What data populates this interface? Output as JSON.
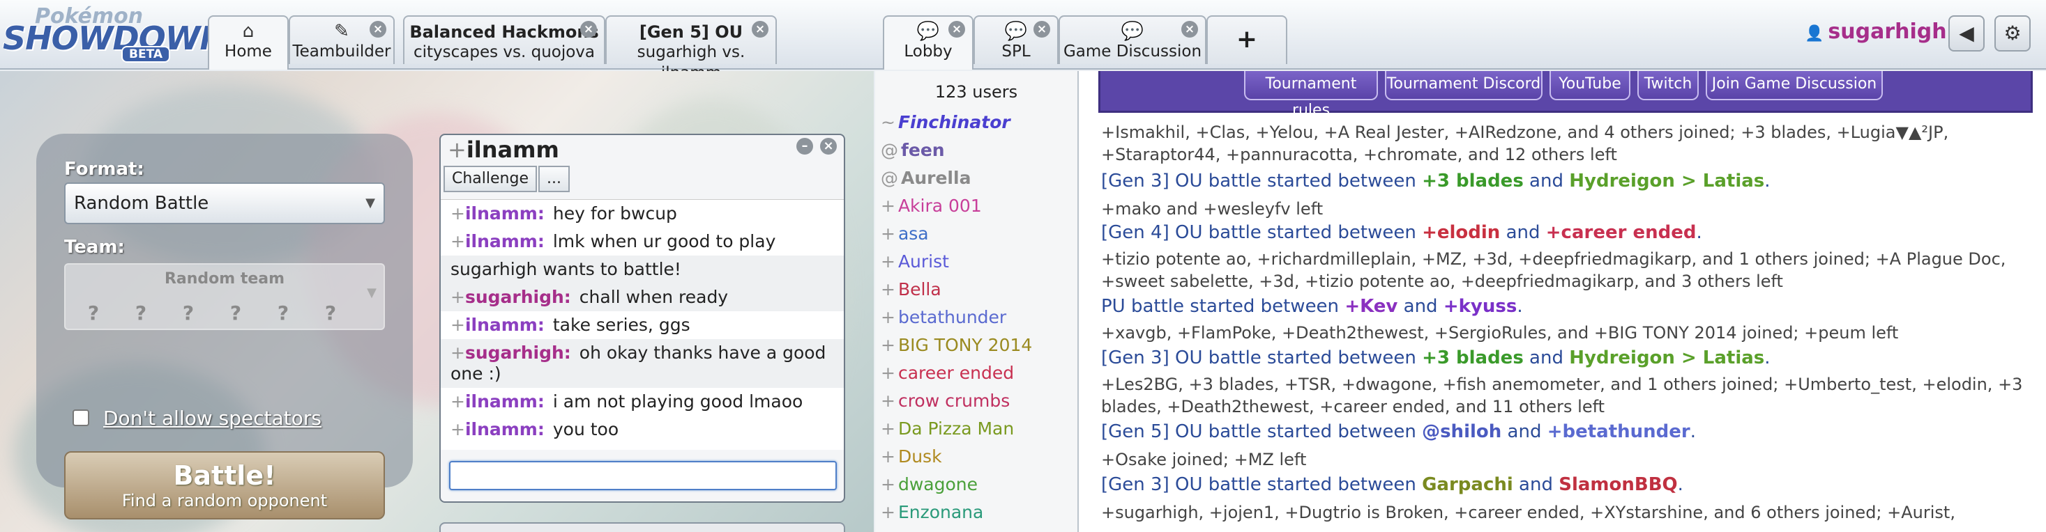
{
  "header": {
    "logo_top": "Pokémon",
    "logo_main": "SHOWDOWN!",
    "logo_badge": "BETA",
    "tabs": [
      {
        "label": "Home",
        "icon": "home-icon"
      },
      {
        "label": "Teambuilder",
        "icon": "edit-icon"
      },
      {
        "line1": "Balanced Hackmons",
        "line2": "cityscapes vs. quojova"
      },
      {
        "line1": "[Gen 5] OU",
        "line2": "sugarhigh vs. ilnamm"
      },
      {
        "label": "Lobby",
        "icon": "chat-bubble-icon"
      },
      {
        "label": "SPL",
        "icon": "chat-bubble-icon"
      },
      {
        "label": "Game Discussion",
        "icon": "chat-bubble-icon"
      }
    ],
    "plus_label": "+",
    "username": "sugarhigh"
  },
  "home": {
    "format_label": "Format:",
    "format_value": "Random Battle",
    "team_label": "Team:",
    "team_value": "Random team",
    "spectators_label": "Don't allow spectators",
    "battle_button": "Battle!",
    "battle_sub": "Find a random opponent"
  },
  "pm": {
    "rank": "+",
    "name": "ilnamm",
    "tools": [
      "Challenge",
      "..."
    ],
    "messages": [
      {
        "rank": "+",
        "who": "ilnamm:",
        "text": "hey for bwcup"
      },
      {
        "rank": "+",
        "who": "ilnamm:",
        "text": "lmk when ur good to play"
      },
      {
        "rank": "",
        "who": "",
        "text": "sugarhigh wants to battle!"
      },
      {
        "rank": "+",
        "who": "sugarhigh:",
        "text": "chall when ready"
      },
      {
        "rank": "+",
        "who": "ilnamm:",
        "text": "take series, ggs"
      },
      {
        "rank": "+",
        "who": "sugarhigh:",
        "text": "oh okay thanks have a good one :)"
      },
      {
        "rank": "+",
        "who": "ilnamm:",
        "text": "i am not playing good lmaoo"
      },
      {
        "rank": "+",
        "who": "ilnamm:",
        "text": "you too"
      }
    ]
  },
  "lobby": {
    "user_count": "123 users",
    "users": [
      {
        "rank": "~",
        "name": "Finchinator",
        "color": "#4a3fd0"
      },
      {
        "rank": "@",
        "name": "feen",
        "color": "#6b5aa8"
      },
      {
        "rank": "@",
        "name": "Aurella",
        "color": "#8a8a8a"
      },
      {
        "rank": "+",
        "name": "Akira 001",
        "color": "#c83f9a"
      },
      {
        "rank": "+",
        "name": "asa",
        "color": "#3f6fc8"
      },
      {
        "rank": "+",
        "name": "Aurist",
        "color": "#5a5ad8"
      },
      {
        "rank": "+",
        "name": "Bella",
        "color": "#c0304a"
      },
      {
        "rank": "+",
        "name": "betathunder",
        "color": "#5a6ad0"
      },
      {
        "rank": "+",
        "name": "BIG TONY 2014",
        "color": "#9a8a20"
      },
      {
        "rank": "+",
        "name": "career ended",
        "color": "#c83050"
      },
      {
        "rank": "+",
        "name": "crow crumbs",
        "color": "#c03060"
      },
      {
        "rank": "+",
        "name": "Da Pizza Man",
        "color": "#7a9a20"
      },
      {
        "rank": "+",
        "name": "Dusk",
        "color": "#b08a20"
      },
      {
        "rank": "+",
        "name": "dwagone",
        "color": "#4aa03a"
      },
      {
        "rank": "+",
        "name": "Enzonana",
        "color": "#2a9a7a"
      }
    ],
    "infobox_buttons": [
      "Tournament rules",
      "Tournament Discord",
      "YouTube",
      "Twitch",
      "Join Game Discussion"
    ],
    "log": [
      {
        "kind": "line",
        "text": "+Ismakhil, +Clas, +Yelou, +A Real Jester, +AIRedzone, and 4 others joined; +3 blades, +Lugia▼▲²JP, +Staraptor44, +pannuracotta, +chromate, and 12 others left"
      },
      {
        "kind": "battle",
        "pre": "[Gen 3] OU battle started between ",
        "p1": "+3 blades",
        "p1color": "#3a9a2a",
        "mid": " and ",
        "p2": "Hydreigon > Latias",
        "p2color": "#5aa02a",
        "post": "."
      },
      {
        "kind": "line",
        "text": "+mako and +wesleyfv left"
      },
      {
        "kind": "battle",
        "pre": "[Gen 4] OU battle started between ",
        "p1": "+elodin",
        "p1color": "#c83040",
        "mid": " and ",
        "p2": "+career ended",
        "p2color": "#c83050",
        "post": "."
      },
      {
        "kind": "line",
        "text": "+tizio potente ao, +richardmilleplain, +MZ, +3d, +deepfriedmagikarp, and 1 others joined; +A Plague Doc, +sweet sabelette, +3d, +tizio potente ao, +deepfriedmagikarp, and 3 others left"
      },
      {
        "kind": "battle",
        "pre": "PU battle started between ",
        "p1": "+Kev",
        "p1color": "#8a30c0",
        "mid": " and ",
        "p2": "+kyuss",
        "p2color": "#7a30c8",
        "post": "."
      },
      {
        "kind": "line",
        "text": "+xavgb, +FlamPoke, +Death2thewest, +SergioRules, and +BIG TONY 2014 joined; +peum left"
      },
      {
        "kind": "battle",
        "pre": "[Gen 3] OU battle started between ",
        "p1": "+3 blades",
        "p1color": "#3a9a2a",
        "mid": " and ",
        "p2": "Hydreigon > Latias",
        "p2color": "#5aa02a",
        "post": "."
      },
      {
        "kind": "line",
        "text": "+Les2BG, +3 blades, +TSR, +dwagone, +fish anemometer, and 1 others joined; +Umberto_test, +elodin, +3 blades, +Death2thewest, +career ended, and 11 others left"
      },
      {
        "kind": "battle",
        "pre": "[Gen 5] OU battle started between ",
        "p1": "@shiloh",
        "p1color": "#4a5ac0",
        "mid": " and ",
        "p2": "+betathunder",
        "p2color": "#5a6ad0",
        "post": "."
      },
      {
        "kind": "line",
        "text": "+Osake joined; +MZ left"
      },
      {
        "kind": "battle",
        "pre": "[Gen 3] OU battle started between ",
        "p1": "Garpachi",
        "p1color": "#7a8a20",
        "mid": " and ",
        "p2": "SlamonBBQ",
        "p2color": "#c03040",
        "post": "."
      },
      {
        "kind": "line",
        "text": "+sugarhigh, +jojen1, +Dugtrio is Broken, +career ended, +XYstarshine, and 6 others joined; +Aurist,"
      }
    ]
  }
}
